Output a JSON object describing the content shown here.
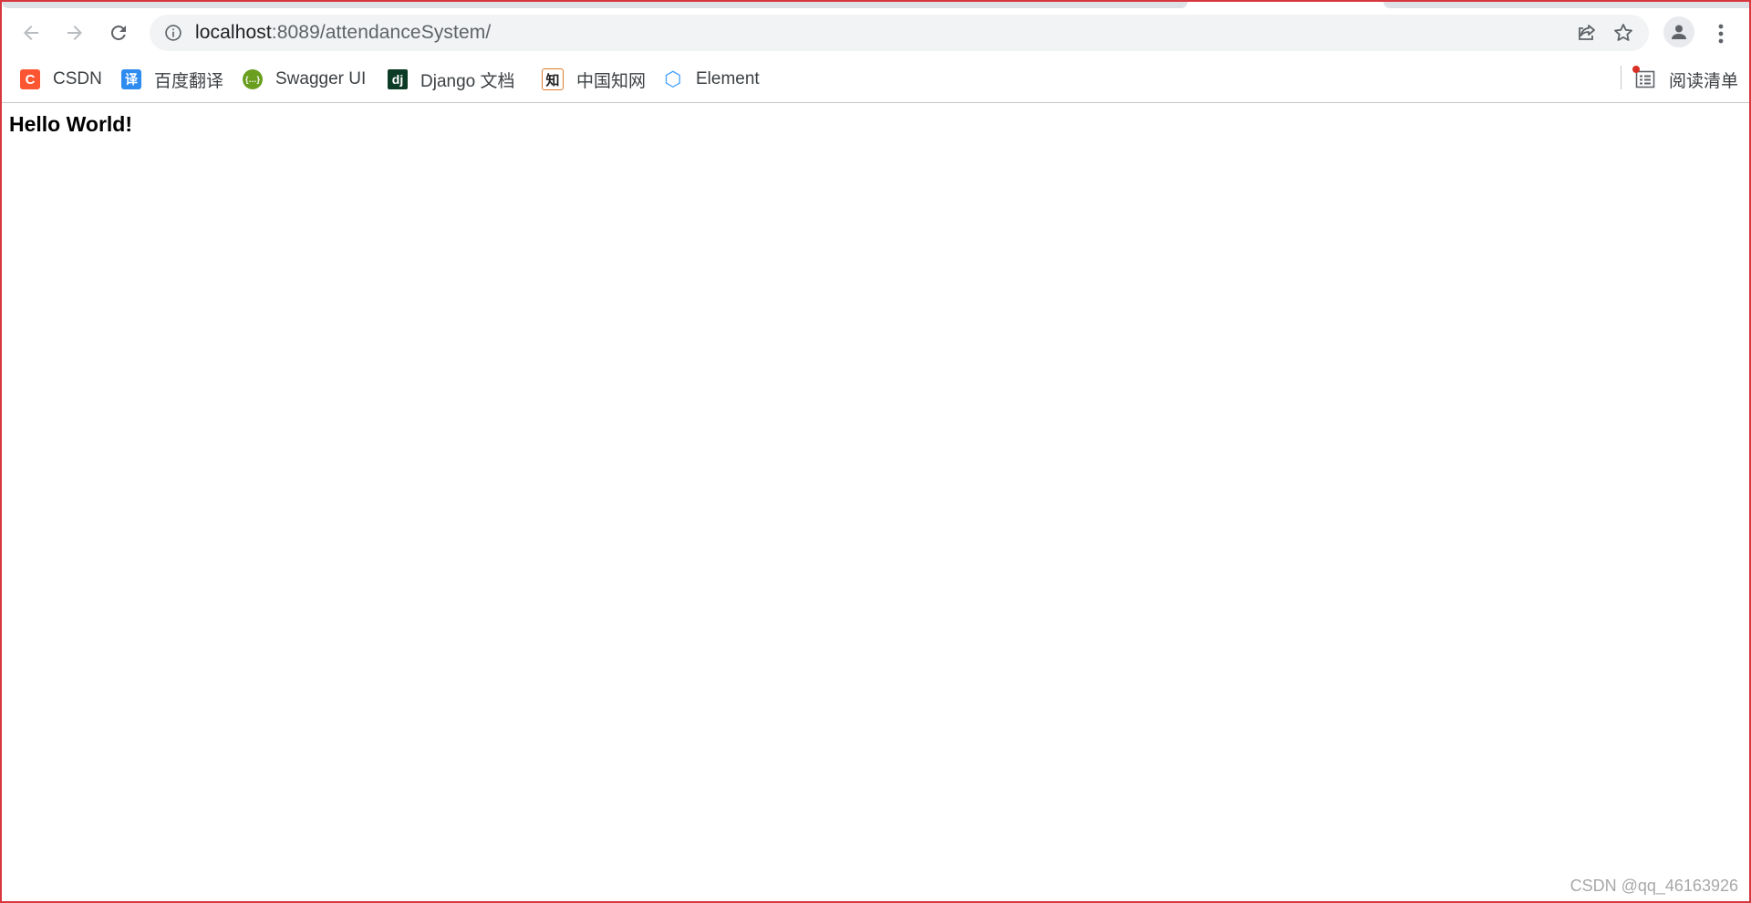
{
  "toolbar": {
    "url_host": "localhost",
    "url_rest": ":8089/attendanceSystem/"
  },
  "bookmarks": [
    {
      "label": "CSDN",
      "icon": "csdn-icon",
      "icon_glyph": "C",
      "color": "#fc5531"
    },
    {
      "label": "百度翻译",
      "icon": "baidu-translate-icon",
      "icon_glyph": "译",
      "color": "#2e8bf0"
    },
    {
      "label": "Swagger UI",
      "icon": "swagger-icon",
      "icon_glyph": "{…}",
      "color": "#6a9e1f"
    },
    {
      "label": "Django 文档",
      "icon": "django-icon",
      "icon_glyph": "dj",
      "color": "#0c3c26"
    },
    {
      "label": "中国知网",
      "icon": "cnki-icon",
      "icon_glyph": "知",
      "color": "#e07b2a"
    },
    {
      "label": "Element",
      "icon": "element-icon",
      "icon_glyph": "⬡",
      "color": "#409eff"
    }
  ],
  "reading_list": {
    "label": "阅读清单"
  },
  "page": {
    "heading": "Hello World!"
  },
  "watermark": "CSDN @qq_46163926"
}
